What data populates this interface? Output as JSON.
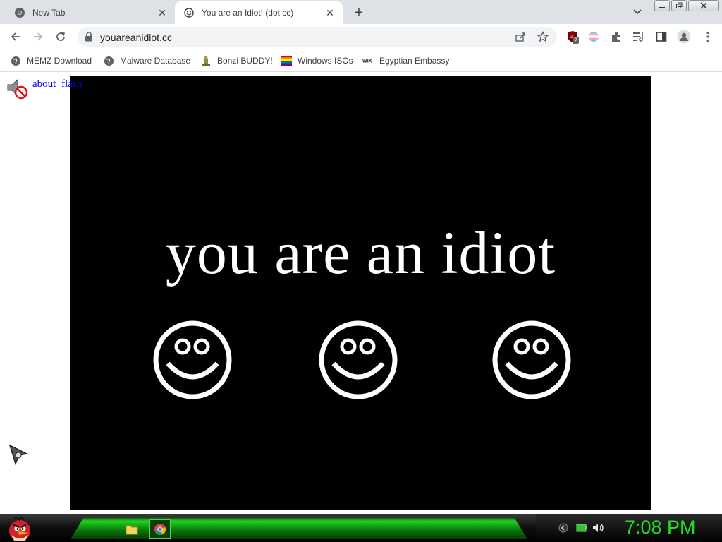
{
  "browser": {
    "tabs": [
      {
        "title": "New Tab",
        "icon": "chrome-icon"
      },
      {
        "title": "You are an Idiot! (dot cc)",
        "icon": "smiley-icon",
        "active": true
      }
    ],
    "address_bar": {
      "url": "youareanidiot.cc"
    },
    "bookmarks": [
      {
        "label": "MEMZ Download",
        "icon": "globe-icon"
      },
      {
        "label": "Malware Database",
        "icon": "globe-icon"
      },
      {
        "label": "Bonzi BUDDY!",
        "icon": "bonzi-icon"
      },
      {
        "label": "Windows ISOs",
        "icon": "windows-flag-icon"
      },
      {
        "label": "Egyptian Embassy",
        "icon": "wix-icon"
      }
    ],
    "extensions": {
      "ublock_badge": "2"
    },
    "colors": {
      "tabstrip": "#dee1e6",
      "link": "#0000ee"
    }
  },
  "page": {
    "links": [
      "about",
      "flash"
    ],
    "headline": "you are an idiot",
    "background": "#000000",
    "foreground": "#ffffff"
  },
  "taskbar": {
    "clock": "7:08 PM",
    "accent": "#22dd22"
  }
}
